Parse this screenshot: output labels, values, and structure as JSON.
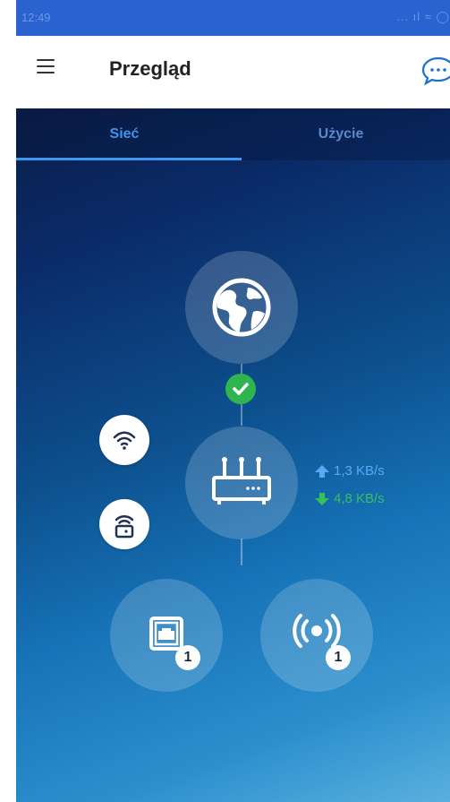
{
  "status_bar": {
    "time": "12:49",
    "signal_icons": "... ıl ≈ ◯"
  },
  "header": {
    "title": "Przegląd"
  },
  "tabs": [
    {
      "label": "Sieć",
      "active": true
    },
    {
      "label": "Użycie",
      "active": false
    }
  ],
  "network": {
    "internet_status": "connected",
    "upload_speed": "1,3 KB/s",
    "download_speed": "4,8 KB/s",
    "wired_clients_count": "1",
    "wireless_clients_count": "1"
  },
  "icons": {
    "menu": "menu-icon",
    "chat": "chat-icon",
    "internet": "globe-icon",
    "router": "router-icon",
    "wifi": "wifi-icon",
    "guest_wifi": "guest-wifi-icon",
    "wired": "ethernet-icon",
    "wireless": "wireless-signal-icon"
  },
  "colors": {
    "status_bar": "#2a63cf",
    "tab_active": "#3e93ea",
    "upload": "#58a8f5",
    "download": "#35c05a",
    "check": "#2eb54f"
  }
}
